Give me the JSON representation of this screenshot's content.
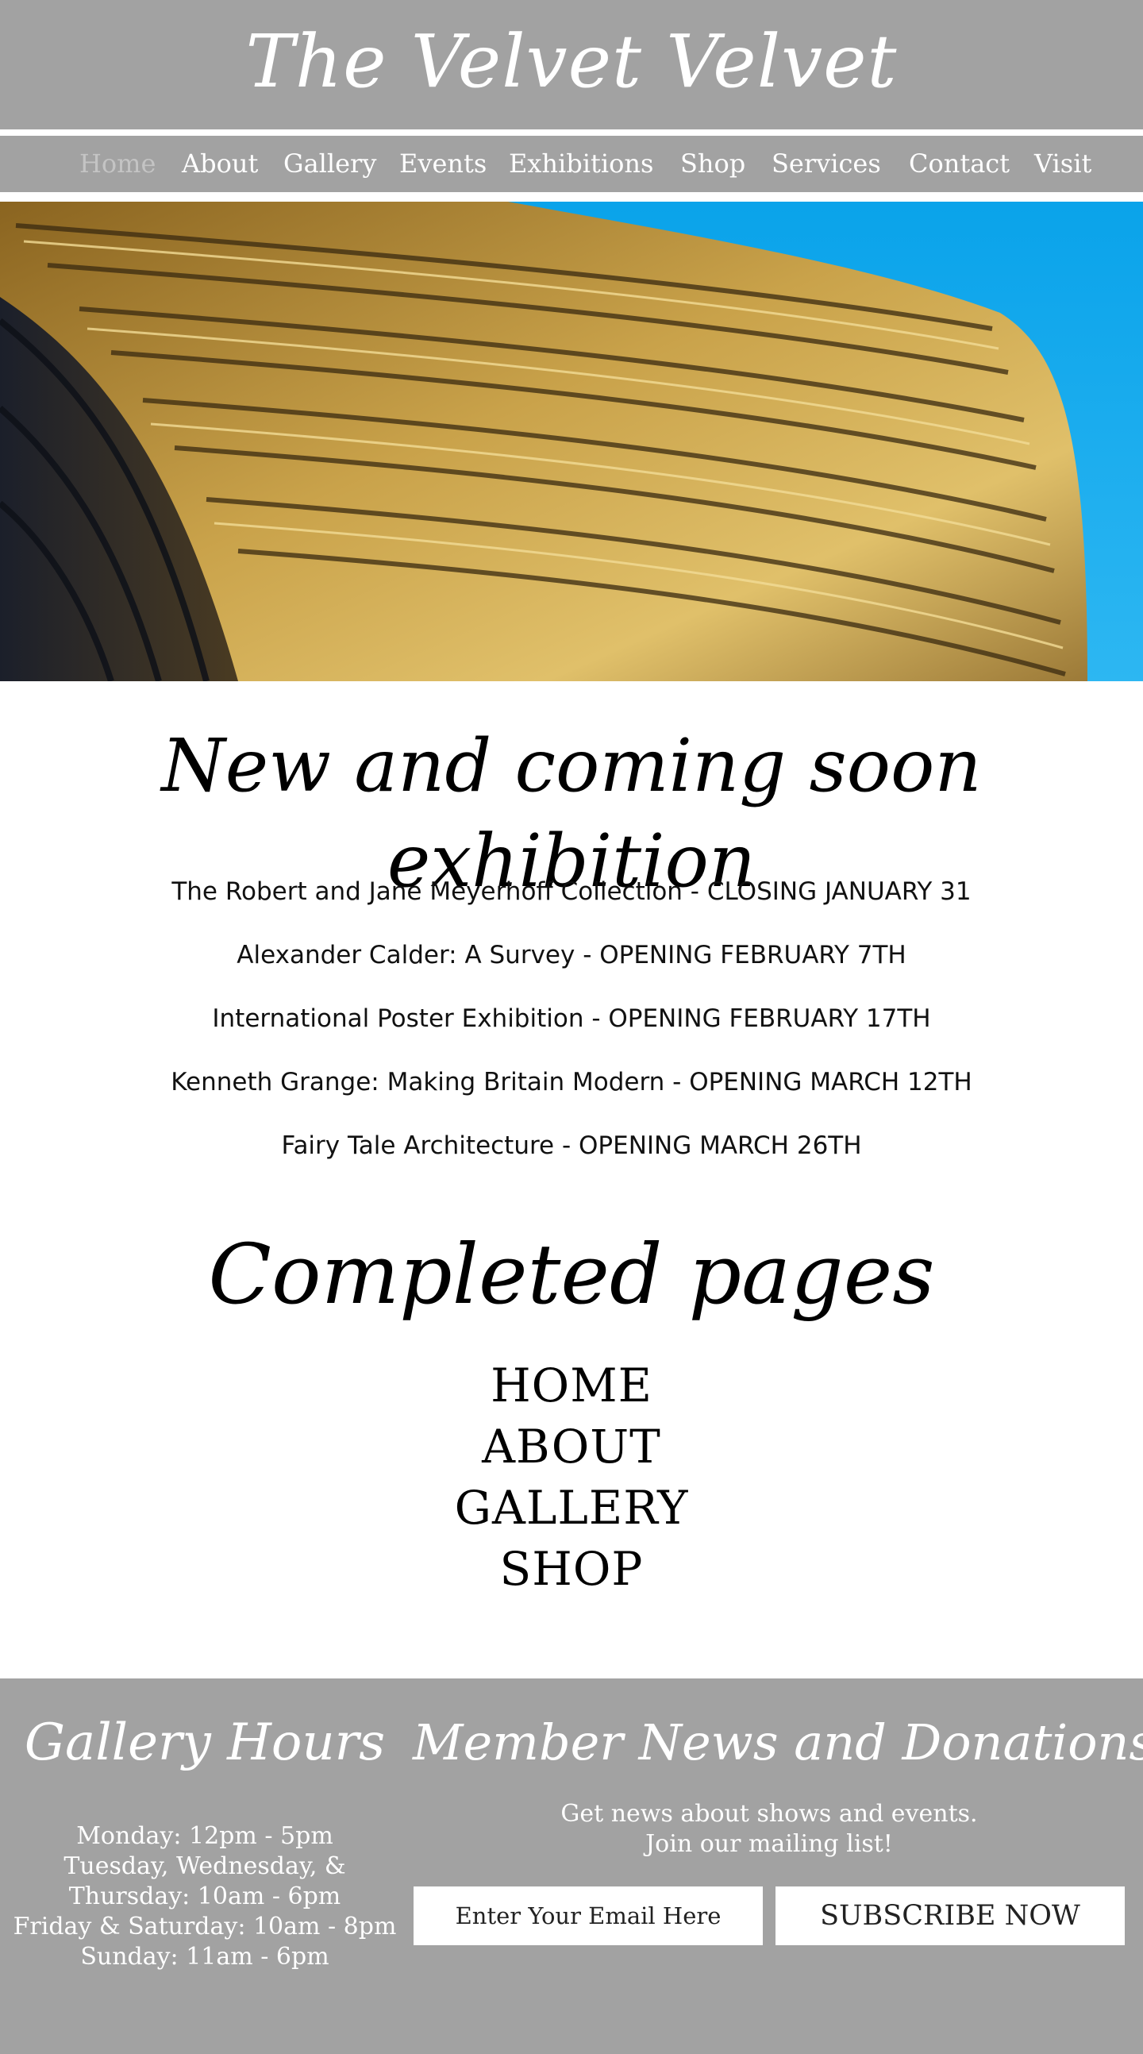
{
  "header": {
    "title": "The Velvet Velvet"
  },
  "nav": {
    "items": [
      {
        "label": "Home",
        "active": true
      },
      {
        "label": "About"
      },
      {
        "label": "Gallery"
      },
      {
        "label": "Events"
      },
      {
        "label": "Exhibitions"
      },
      {
        "label": "Shop"
      },
      {
        "label": "Services"
      },
      {
        "label": "Contact"
      },
      {
        "label": "Visit"
      }
    ]
  },
  "exhibitions": {
    "heading": "New and coming soon exhibition",
    "items": [
      "The Robert and Jane Meyerhoff Collection - CLOSING JANUARY 31",
      "Alexander Calder: A Survey - OPENING FEBRUARY 7TH",
      "International Poster Exhibition - OPENING FEBRUARY 17TH",
      "Kenneth Grange: Making Britain Modern - OPENING MARCH 12TH",
      "Fairy Tale Architecture - OPENING MARCH 26TH"
    ]
  },
  "completed": {
    "heading": "Completed pages",
    "links": [
      "HOME",
      "ABOUT",
      "GALLERY",
      "SHOP"
    ]
  },
  "footer": {
    "hours": {
      "title": "Gallery Hours",
      "lines": [
        "Monday: 12pm - 5pm",
        "Tuesday, Wednesday, &",
        "Thursday: 10am - 6pm",
        "Friday & Saturday: 10am - 8pm",
        "Sunday: 11am - 6pm"
      ]
    },
    "member": {
      "title": "Member News and Donations",
      "lines": [
        "Get news about shows and events.",
        "Join our mailing list!"
      ],
      "email_placeholder": "Enter Your Email Here",
      "subscribe_label": "SUBSCRIBE NOW"
    }
  },
  "colors": {
    "header_bg": "#a2a2a2",
    "footer_bg": "#a2a2a2",
    "nav_active": "#c4c4c4",
    "sky": "#10a8ec",
    "facade_gold": "#c9a24a"
  }
}
